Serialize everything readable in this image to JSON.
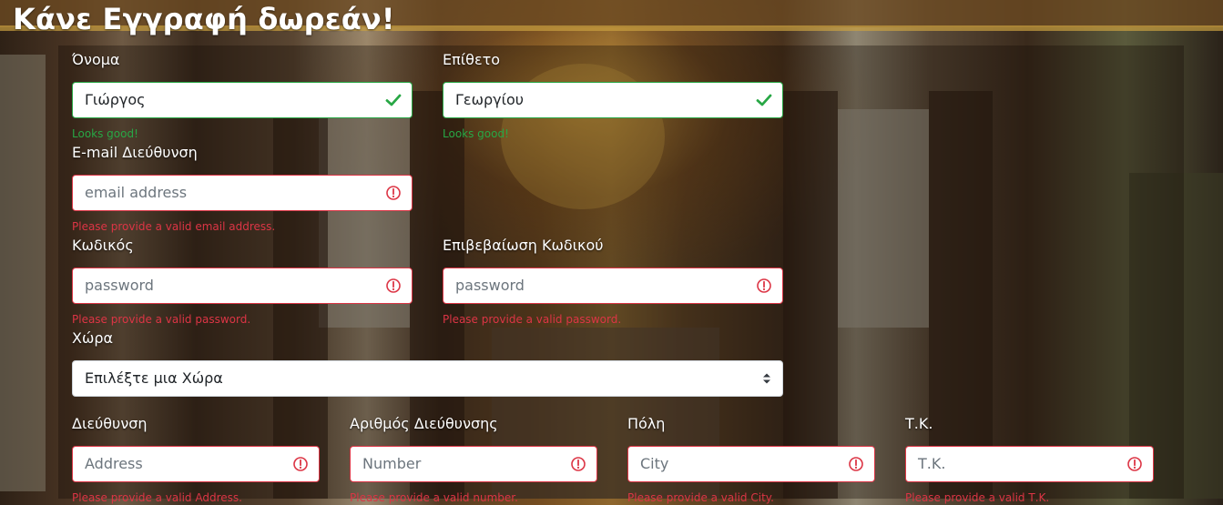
{
  "page": {
    "title": "Κάνε Εγγραφή δωρεάν!"
  },
  "colors": {
    "valid": "#28a745",
    "invalid": "#dc3545",
    "label": "#ffffff"
  },
  "form": {
    "first_name": {
      "label": "Όνομα",
      "value": "Γιώργος",
      "feedback": "Looks good!",
      "state": "valid",
      "icon": "check-icon"
    },
    "last_name": {
      "label": "Επίθετο",
      "value": "Γεωργίου",
      "feedback": "Looks good!",
      "state": "valid",
      "icon": "check-icon"
    },
    "email": {
      "label": "E-mail Διεύθυνση",
      "placeholder": "email address",
      "feedback": "Please provide a valid email address.",
      "state": "invalid",
      "icon": "alert-circle-icon"
    },
    "password": {
      "label": "Κωδικός",
      "placeholder": "password",
      "feedback": "Please provide a valid password.",
      "state": "invalid",
      "icon": "alert-circle-icon"
    },
    "confirm_password": {
      "label": "Επιβεβαίωση Κωδικού",
      "placeholder": "password",
      "feedback": "Please provide a valid password.",
      "state": "invalid",
      "icon": "alert-circle-icon"
    },
    "country": {
      "label": "Χώρα",
      "selected": "Επιλέξτε μια Χώρα",
      "icon": "select-arrows-icon"
    },
    "address": {
      "label": "Διεύθυνση",
      "placeholder": "Address",
      "feedback": "Please provide a valid Address.",
      "state": "invalid",
      "icon": "alert-circle-icon"
    },
    "number": {
      "label": "Αριθμός Διεύθυνσης",
      "placeholder": "Number",
      "feedback": "Please provide a valid number.",
      "state": "invalid",
      "icon": "alert-circle-icon"
    },
    "city": {
      "label": "Πόλη",
      "placeholder": "City",
      "feedback": "Please provide a valid City.",
      "state": "invalid",
      "icon": "alert-circle-icon"
    },
    "zip": {
      "label": "Τ.Κ.",
      "placeholder": "Τ.Κ.",
      "feedback": "Please provide a valid Τ.Κ.",
      "state": "invalid",
      "icon": "alert-circle-icon"
    }
  }
}
